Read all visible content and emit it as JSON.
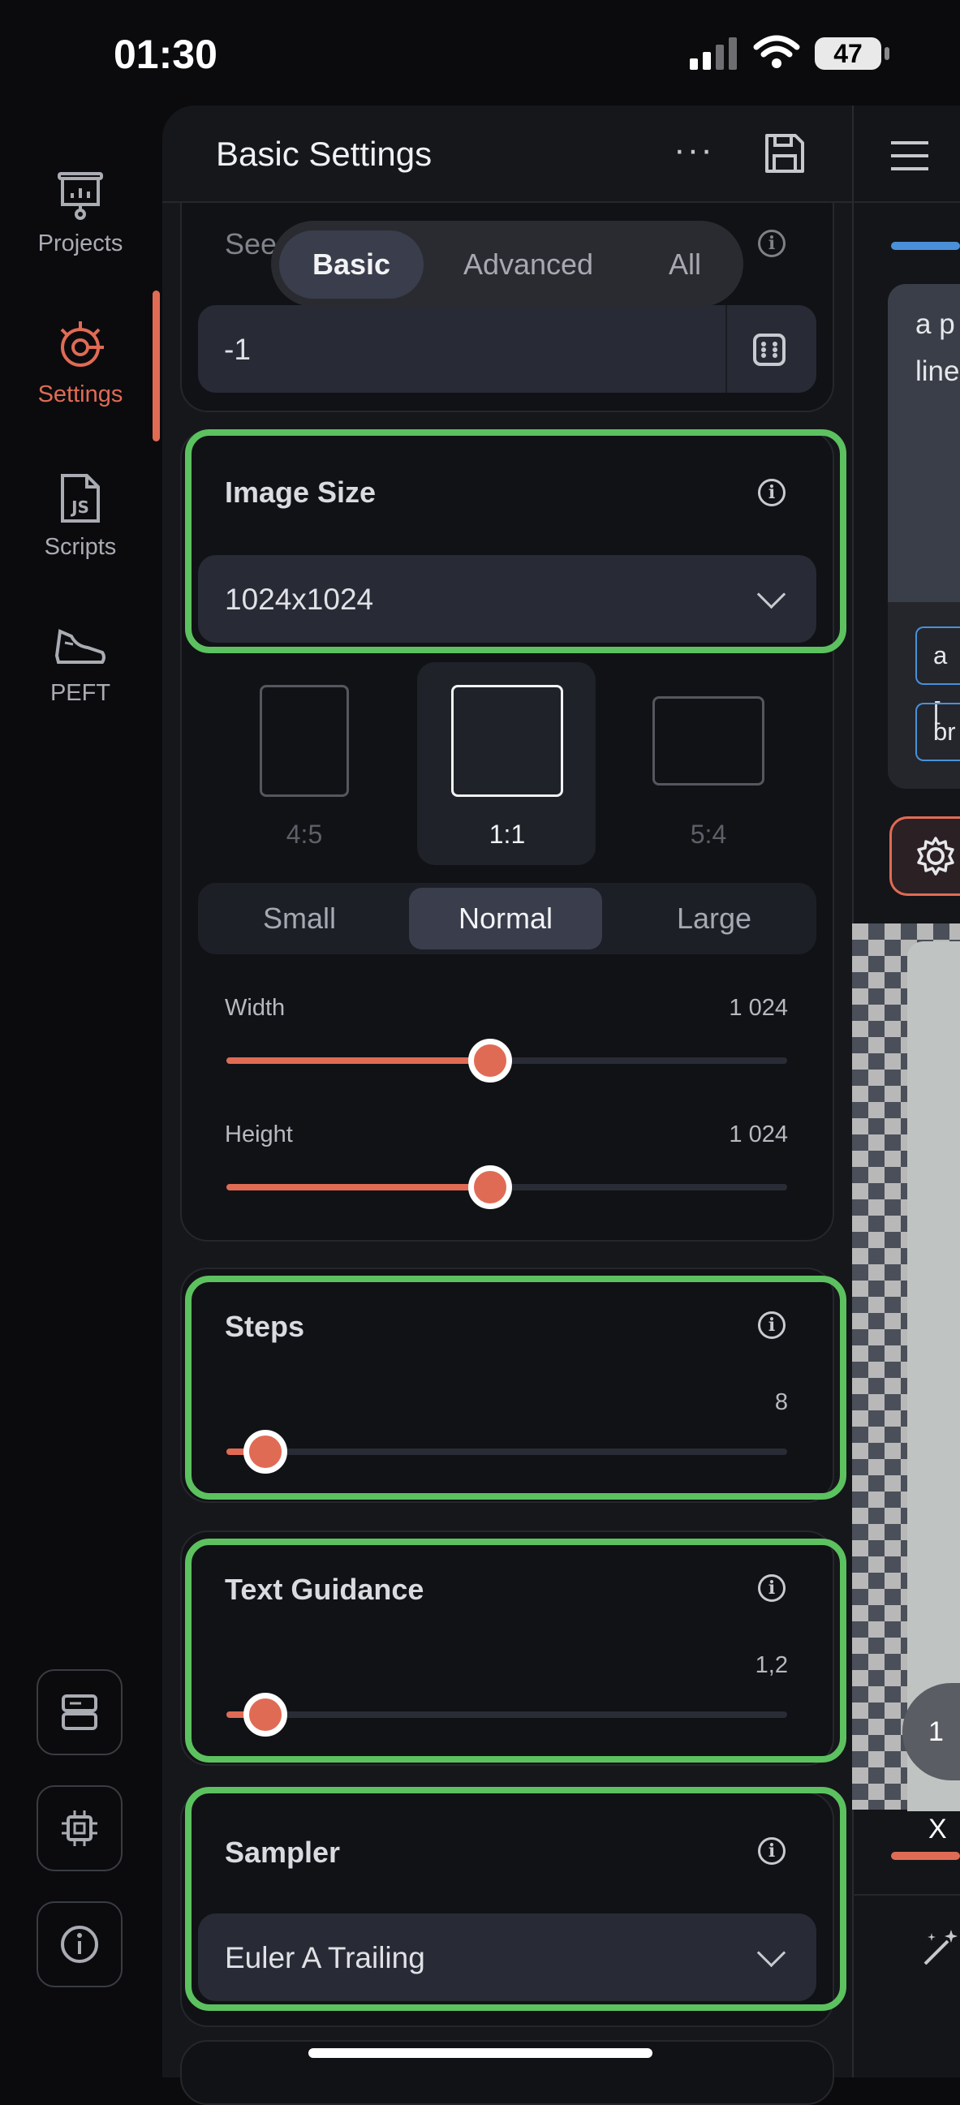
{
  "status_bar": {
    "time": "01:30",
    "battery": "47"
  },
  "rail": {
    "items": [
      {
        "label": "Projects",
        "icon": "presentation-icon"
      },
      {
        "label": "Settings",
        "icon": "settings-icon"
      },
      {
        "label": "Scripts",
        "icon": "js-file-icon"
      },
      {
        "label": "PEFT",
        "icon": "shoe-icon"
      }
    ],
    "bottom_icons": [
      "storage-icon",
      "chip-icon",
      "info-icon"
    ]
  },
  "header": {
    "title": "Basic Settings",
    "more": "···"
  },
  "mode_tabs": {
    "items": [
      "Basic",
      "Advanced",
      "All"
    ],
    "selected": "Basic"
  },
  "seed": {
    "label": "Seed",
    "value": "-1"
  },
  "image_size": {
    "label": "Image Size",
    "value": "1024x1024",
    "ratios": [
      "4:5",
      "1:1",
      "5:4"
    ],
    "selected_ratio": "1:1",
    "sizes": [
      "Small",
      "Normal",
      "Large"
    ],
    "selected_size": "Normal",
    "width_label": "Width",
    "width_value": "1 024",
    "width_fraction": 0.47,
    "height_label": "Height",
    "height_value": "1 024",
    "height_fraction": 0.47
  },
  "steps": {
    "label": "Steps",
    "value": "8",
    "fraction": 0.07
  },
  "text_guidance": {
    "label": "Text Guidance",
    "value": "1,2",
    "fraction": 0.07
  },
  "sampler": {
    "label": "Sampler",
    "value": "Euler A Trailing"
  },
  "preview": {
    "prompt_text": "a p",
    "prompt_text_2": "line",
    "chip_1": "a [",
    "chip_2": "br",
    "zoom_label": "1 X"
  },
  "colors": {
    "accent": "#e06b55",
    "highlight": "#5cc25f",
    "background": "#0b0b0d"
  }
}
